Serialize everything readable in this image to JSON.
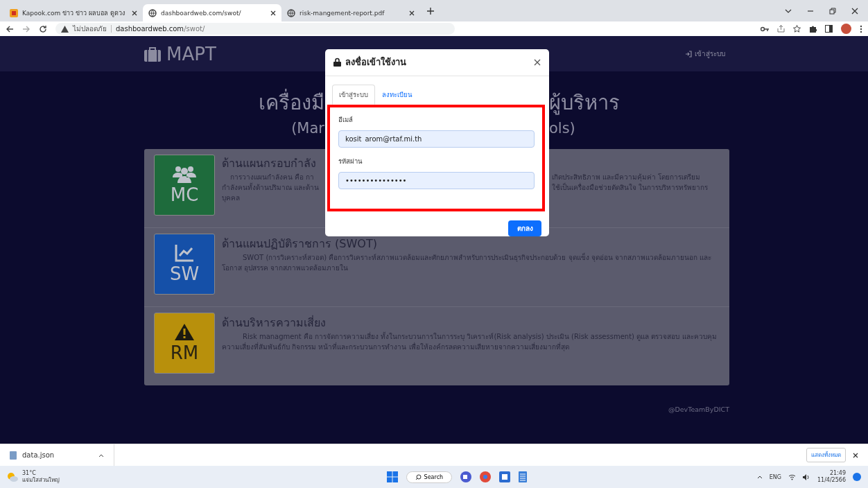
{
  "browser": {
    "tabs": [
      {
        "title": "Kapook.com ข่าว ข่าว ผลบอล ดูดวง",
        "selected": false
      },
      {
        "title": "dashboardweb.com/swot/",
        "selected": true
      },
      {
        "title": "risk-mangement-report.pdf",
        "selected": false
      }
    ],
    "security": "ไม่ปลอดภัย",
    "url_host": "dashboardweb.com",
    "url_path": "/swot/"
  },
  "navbar": {
    "brand": "MAPT",
    "login": "เข้าสู่ระบบ"
  },
  "heading": [
    "เครื่องมื",
    "ผู้บริหาร"
  ],
  "subtitle": [
    "(Mar",
    "ols)"
  ],
  "cards": [
    {
      "badge": "MC",
      "kind": "people",
      "color": "#1e6b3c",
      "title": "ด้านแผนกรอบกำลัง",
      "lines": [
        [
          "การวางแผนกำลังคน คือ กา",
          "เกิดประสิทธิภาพ และมีความคุ้มค่า โดยการเตรียม"
        ],
        [
          "กำลังคนทั้งด้านปริมาณ และด้าน",
          "ใช้เป็นเครื่องมือช่วยตัดสินใจ ในการบริหารทรัพยากร"
        ],
        [
          "บุคคล"
        ]
      ]
    },
    {
      "badge": "SW",
      "kind": "chart",
      "color": "#1550a8",
      "title": "ด้านแผนปฏิบัติราชการ (SWOT)",
      "lines": [
        [
          "SWOT (การวิเคราะห์สวอต) คือการวิเคราะห์สภาพแวดล้อมและศักยภาพสำหรับการประเมินธุรกิจประกอบด้วย จุดแข็ง จุดอ่อน จากสภาพแวดล้อมภายนอก และ โอกาส อุปสรรค จากสภาพแวดล้อมภายใน"
        ]
      ]
    },
    {
      "badge": "RM",
      "kind": "warning",
      "color": "#b8900c",
      "title": "ด้านบริหารความเสี่ยง",
      "lines": [
        [
          "Risk managment คือ การจัดการความเสี่ยง ทั้งในกระบวนการในการระบุ วิเคราะห์(Risk analysis) ประเมิน (Risk assessment) ดูแล ตรวจสอบ และควบคุมความเสี่ยงที่สัมพันธ์กับ กิจกรรม หน้าที่และกระบวนการทำงาน เพื่อให้องค์กรลดความเสียหายจากความเสี่ยงมากที่สุด"
        ]
      ]
    }
  ],
  "footer": "@DevTeamByDICT",
  "dialog": {
    "title": "ลงชื่อเข้าใช้งาน",
    "tabs": [
      {
        "label": "เข้าสู่ระบบ",
        "selected": true
      },
      {
        "label": "ลงทะเบียน",
        "selected": false
      }
    ],
    "email_label": "อีเมล์",
    "email": "kosit_arom@rtaf.mi.th",
    "password_label": "รหัสผ่าน",
    "password": "•••••••••••••••",
    "submit": "ตกลง"
  },
  "downloads": {
    "file": "data.json",
    "show_all": "แสดงทั้งหมด"
  },
  "taskbar": {
    "temperature": "31°C",
    "weather": "แจ่มใสส่วนใหญ่",
    "search": "Search",
    "language": "ENG",
    "time": "21:49",
    "date": "11/4/2566"
  }
}
